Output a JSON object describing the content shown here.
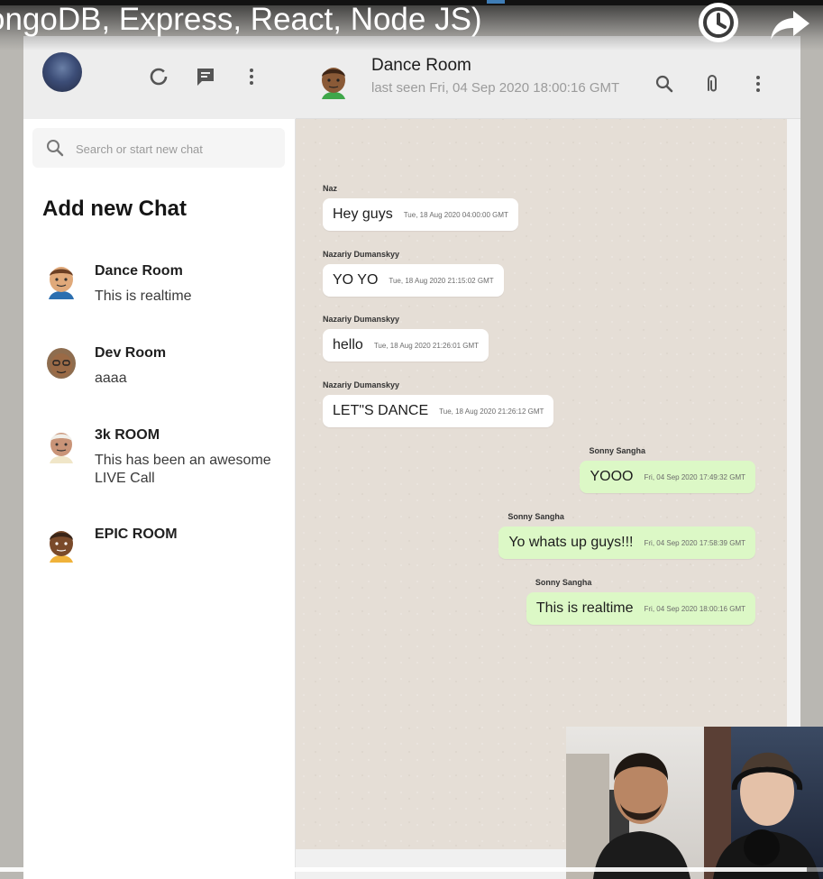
{
  "video": {
    "title": "ongoDB, Express, React, Node JS)",
    "watch_later_icon": "clock-icon",
    "share_icon": "share-arrow-icon",
    "progress_fraction": 0.98
  },
  "sidebar": {
    "header_icons": [
      "status-ring-icon",
      "new-chat-icon",
      "more-vert-icon"
    ],
    "search_placeholder": "Search or start new chat",
    "add_new_chat": "Add new Chat",
    "chats": [
      {
        "name": "Dance Room",
        "last": "This is realtime"
      },
      {
        "name": "Dev Room",
        "last": "aaaa"
      },
      {
        "name": "3k ROOM",
        "last": "This has been an awesome LIVE Call"
      },
      {
        "name": "EPIC ROOM",
        "last": ""
      }
    ]
  },
  "chat": {
    "room_name": "Dance Room",
    "last_seen": "last seen Fri, 04 Sep 2020 18:00:16 GMT",
    "header_icons": [
      "search-icon",
      "attach-icon",
      "more-vert-icon"
    ],
    "messages": [
      {
        "author": "Naz",
        "text": "Hey guys",
        "time": "Tue, 18 Aug 2020 04:00:00 GMT",
        "mine": false
      },
      {
        "author": "Nazariy Dumanskyy",
        "text": "YO YO",
        "time": "Tue, 18 Aug 2020 21:15:02 GMT",
        "mine": false
      },
      {
        "author": "Nazariy Dumanskyy",
        "text": "hello",
        "time": "Tue, 18 Aug 2020 21:26:01 GMT",
        "mine": false
      },
      {
        "author": "Nazariy Dumanskyy",
        "text": "LET\"S DANCE",
        "time": "Tue, 18 Aug 2020 21:26:12 GMT",
        "mine": false
      },
      {
        "author": "Sonny Sangha",
        "text": "YOOO",
        "time": "Fri, 04 Sep 2020 17:49:32 GMT",
        "mine": true
      },
      {
        "author": "Sonny Sangha",
        "text": "Yo whats up guys!!!",
        "time": "Fri, 04 Sep 2020 17:58:39 GMT",
        "mine": true
      },
      {
        "author": "Sonny Sangha",
        "text": "This is realtime",
        "time": "Fri, 04 Sep 2020 18:00:16 GMT",
        "mine": true
      }
    ]
  },
  "colors": {
    "outgoing_bubble": "#dcf8c6",
    "incoming_bubble": "#ffffff",
    "chat_background": "#e5ded6",
    "header_background": "#ededed"
  }
}
